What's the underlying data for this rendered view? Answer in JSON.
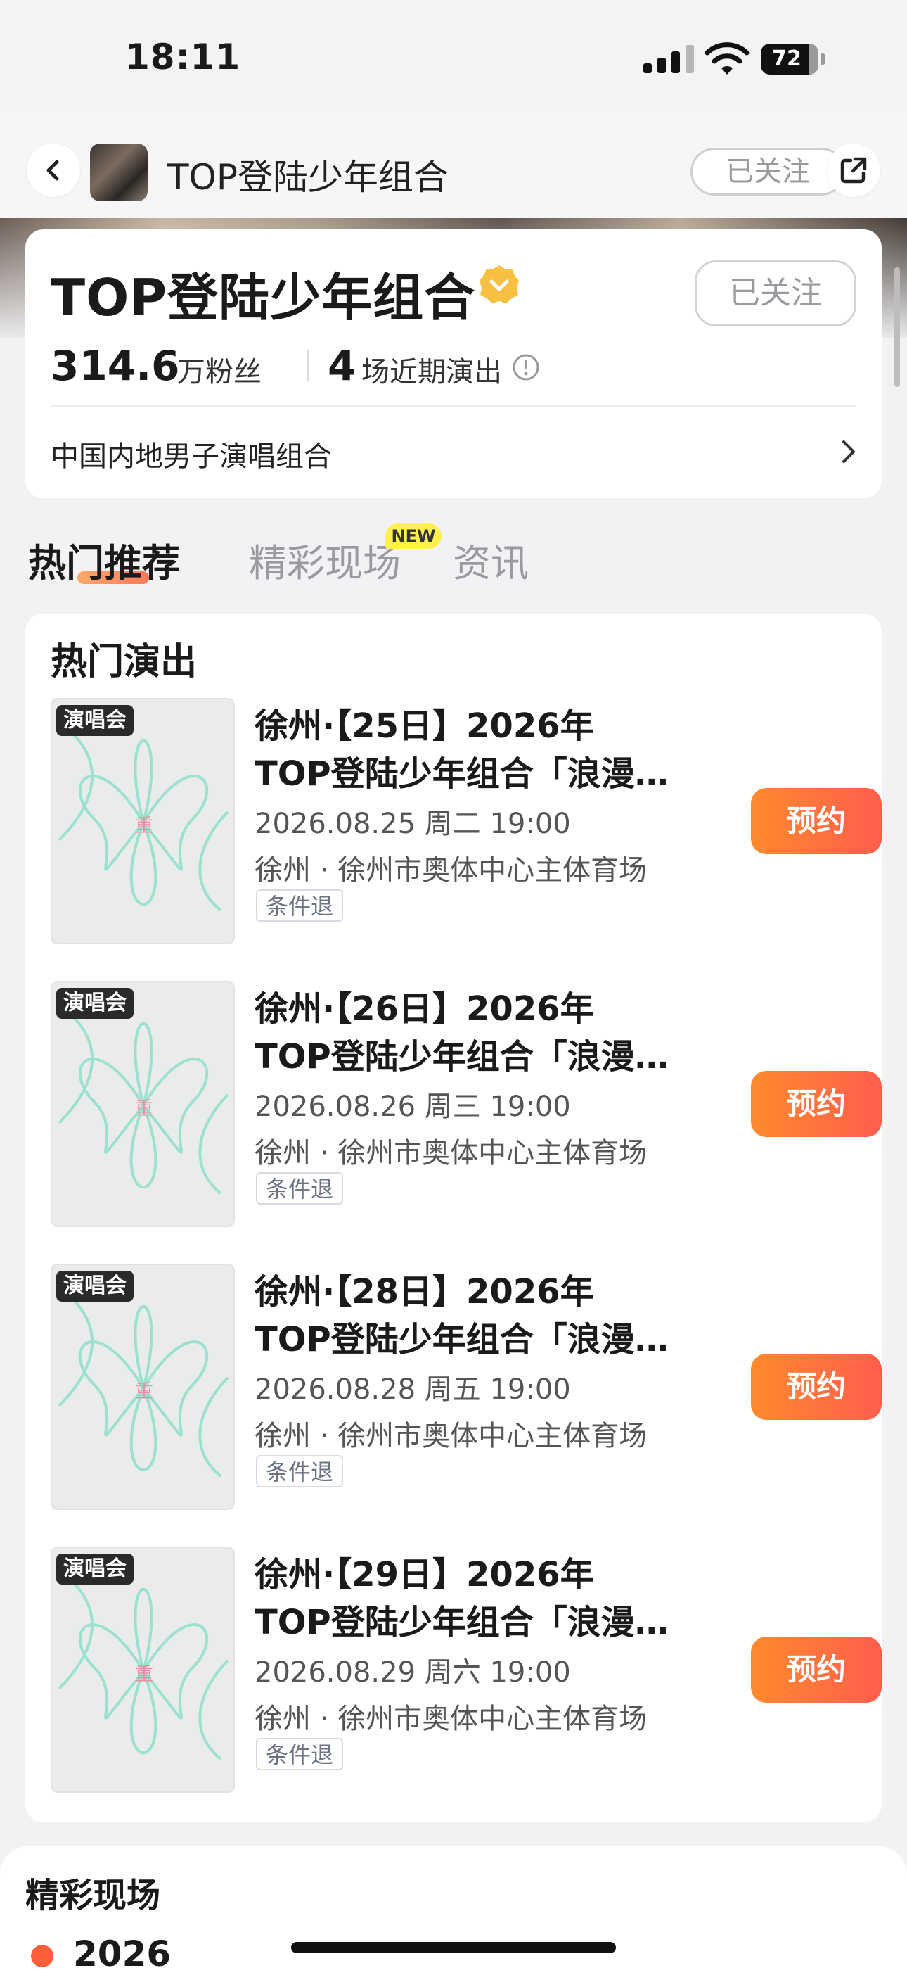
{
  "status_bar": {
    "time": "18:11",
    "battery": "72"
  },
  "nav": {
    "title": "TOP登陆少年组合",
    "follow_label": "已关注"
  },
  "artist": {
    "name": "TOP登陆少年组合",
    "follow_label": "已关注",
    "fans_count": "314.6",
    "fans_label": "万粉丝",
    "shows_count": "4",
    "shows_label": "场近期演出",
    "description": "中国内地男子演唱组合"
  },
  "tabs": [
    {
      "label": "热门推荐",
      "active": true
    },
    {
      "label": "精彩现场",
      "badge": "NEW"
    },
    {
      "label": "资讯"
    }
  ],
  "hot_shows": {
    "title": "热门演出",
    "items": [
      {
        "tag": "演唱会",
        "title_line1": "徐州·【25日】2026年",
        "title_line2": "TOP登陆少年组合「浪漫…",
        "datetime": "2026.08.25 周二 19:00",
        "venue": "徐州 · 徐州市奥体中心主体育场",
        "refund_tag": "条件退",
        "button": "预约"
      },
      {
        "tag": "演唱会",
        "title_line1": "徐州·【26日】2026年",
        "title_line2": "TOP登陆少年组合「浪漫…",
        "datetime": "2026.08.26 周三 19:00",
        "venue": "徐州 · 徐州市奥体中心主体育场",
        "refund_tag": "条件退",
        "button": "预约"
      },
      {
        "tag": "演唱会",
        "title_line1": "徐州·【28日】2026年",
        "title_line2": "TOP登陆少年组合「浪漫…",
        "datetime": "2026.08.28 周五 19:00",
        "venue": "徐州 · 徐州市奥体中心主体育场",
        "refund_tag": "条件退",
        "button": "预约"
      },
      {
        "tag": "演唱会",
        "title_line1": "徐州·【29日】2026年",
        "title_line2": "TOP登陆少年组合「浪漫…",
        "datetime": "2026.08.29 周六 19:00",
        "venue": "徐州 · 徐州市奥体中心主体育场",
        "refund_tag": "条件退",
        "button": "预约"
      }
    ]
  },
  "live_section": {
    "title": "精彩现场",
    "year": "2026"
  },
  "colors": {
    "accent": "#ff6a3d",
    "text": "#1a1a1a",
    "muted": "#9a9aa0"
  }
}
